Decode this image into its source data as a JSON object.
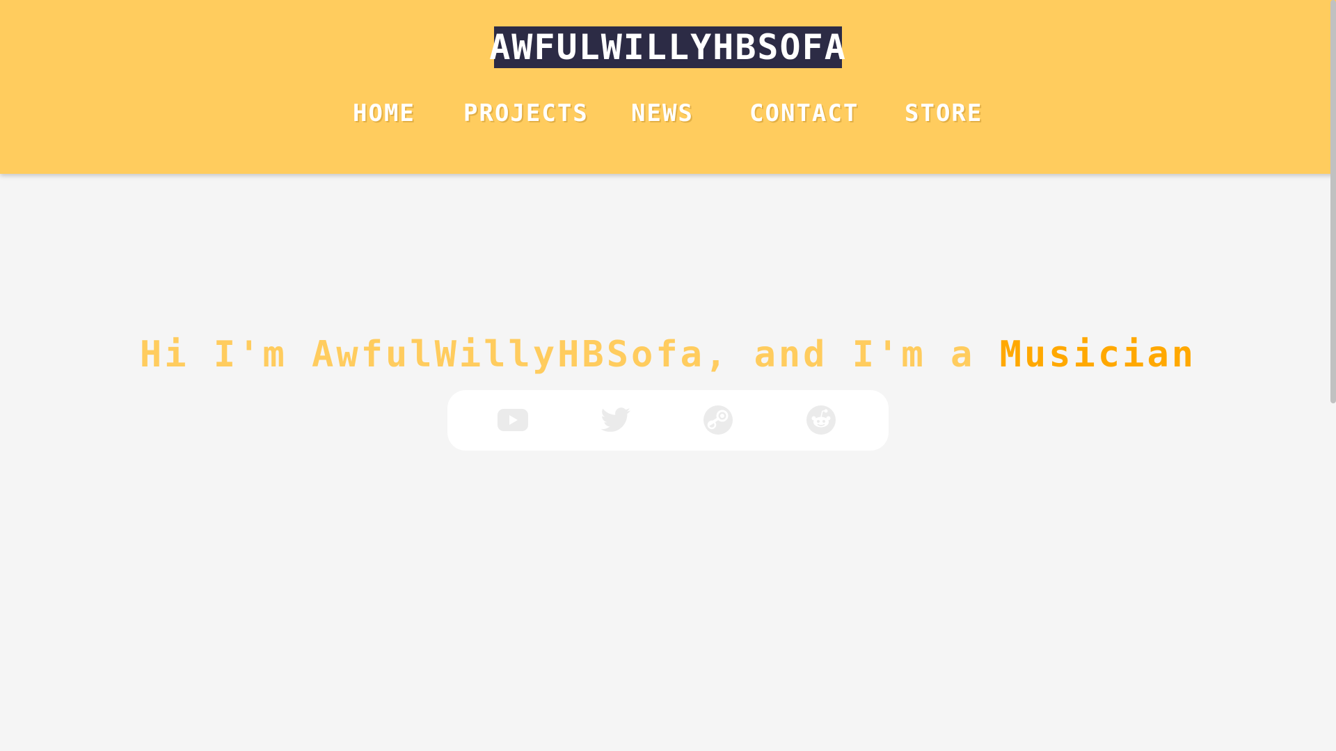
{
  "logo": {
    "text": "AwfulWillyHBSofa"
  },
  "nav": {
    "items": [
      {
        "label": "Home"
      },
      {
        "label": "Projects"
      },
      {
        "label": "News"
      },
      {
        "label": "Contact"
      },
      {
        "label": "Store"
      }
    ]
  },
  "hero": {
    "intro": "Hi I'm AwfulWillyHBSofa, and I'm a ",
    "role": "Musician"
  },
  "social": {
    "icons": [
      "youtube-icon",
      "twitter-icon",
      "steam-icon",
      "reddit-icon"
    ]
  },
  "colors": {
    "header_bg": "#ffcc5e",
    "logo_bg": "#2c2b45",
    "hero_intro": "#ffcc5e",
    "hero_role": "#ffa800",
    "page_bg": "#f5f5f5",
    "icon": "#ebebeb"
  }
}
